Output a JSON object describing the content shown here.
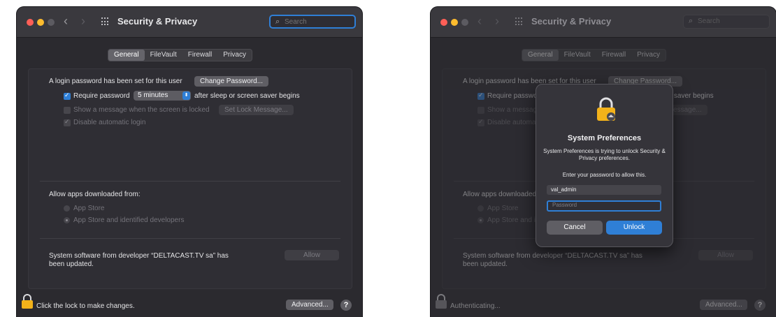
{
  "left_window": {
    "title": "Security & Privacy",
    "search_placeholder": "Search",
    "tabs": [
      "General",
      "FileVault",
      "Firewall",
      "Privacy"
    ],
    "selected_tab": "General",
    "login_text": "A login password has been set for this user",
    "change_password_label": "Change Password...",
    "require_password_label": "Require password",
    "require_password_checked": true,
    "require_interval": "5 minutes",
    "after_sleep_label": "after sleep or screen saver begins",
    "show_message_label": "Show a message when the screen is locked",
    "set_lock_message_label": "Set Lock Message...",
    "disable_login_label": "Disable automatic login",
    "allow_apps_label": "Allow apps downloaded from:",
    "app_store_label": "App Store",
    "app_store_dev_label": "App Store and identified developers",
    "system_software_text": "System software from developer “DELTACAST.TV sa” has been updated.",
    "allow_label": "Allow",
    "lock_text": "Click the lock to make changes.",
    "advanced_label": "Advanced...",
    "help_label": "?"
  },
  "right_window": {
    "title": "Security & Privacy",
    "search_placeholder": "Search",
    "tabs": [
      "General",
      "FileVault",
      "Firewall",
      "Privacy"
    ],
    "login_text": "A login password has been set for this user",
    "change_password_label": "Change Password...",
    "require_password_label": "Require password",
    "after_sleep_label": "after sleep or screen saver begins",
    "show_message_label": "Show a message when the screen is locked",
    "set_lock_message_label": "Set Lock Message...",
    "disable_login_label": "Disable automatic login",
    "allow_apps_label": "Allow apps downloaded from:",
    "app_store_label": "App Store",
    "app_store_dev_label": "App Store and identified developers",
    "system_software_text": "System software from developer “DELTACAST.TV sa” has been updated.",
    "allow_label": "Allow",
    "lock_text": "Authenticating...",
    "advanced_label": "Advanced...",
    "help_label": "?"
  },
  "dialog": {
    "title": "System Preferences",
    "message": "System Preferences is trying to unlock Security & Privacy preferences.",
    "prompt": "Enter your password to allow this.",
    "username": "val_admin",
    "password_placeholder": "Password",
    "cancel_label": "Cancel",
    "unlock_label": "Unlock"
  },
  "colors": {
    "accent": "#2f7fd6",
    "window_bg": "#2b2a2f",
    "close": "#ff5f57",
    "minimize": "#febc2e",
    "zoom_inactive": "#5c5b61",
    "lock": "#f3b21a"
  }
}
